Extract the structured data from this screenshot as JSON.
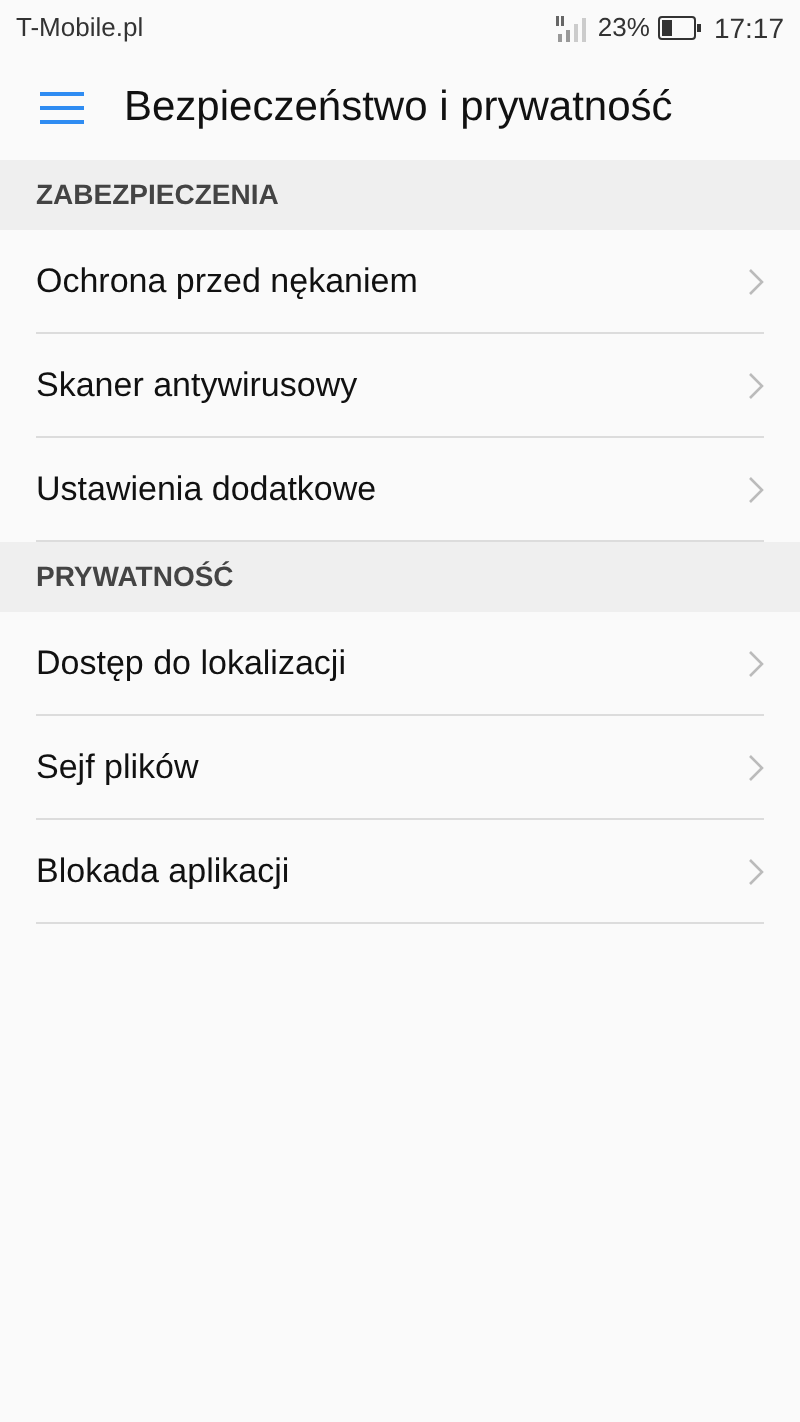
{
  "status_bar": {
    "carrier": "T-Mobile.pl",
    "battery": "23%",
    "time": "17:17"
  },
  "toolbar": {
    "title": "Bezpieczeństwo i prywatność"
  },
  "sections": [
    {
      "title": "ZABEZPIECZENIA",
      "items": [
        {
          "label": "Ochrona przed nękaniem"
        },
        {
          "label": "Skaner antywirusowy"
        },
        {
          "label": "Ustawienia dodatkowe"
        }
      ]
    },
    {
      "title": "PRYWATNOŚĆ",
      "items": [
        {
          "label": "Dostęp do lokalizacji"
        },
        {
          "label": "Sejf plików"
        },
        {
          "label": "Blokada aplikacji"
        }
      ]
    }
  ]
}
